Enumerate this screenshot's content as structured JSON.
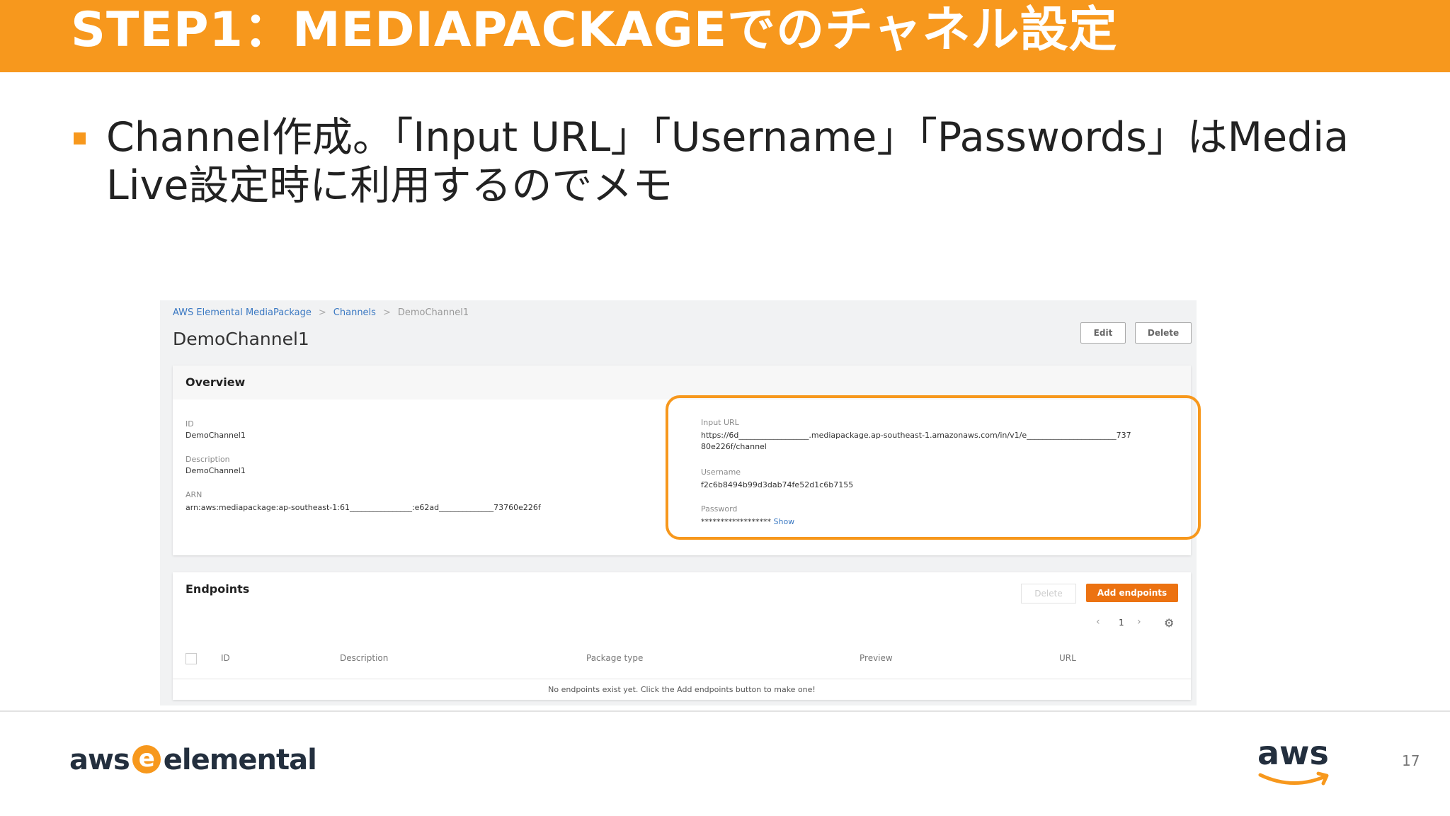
{
  "slide": {
    "title": "STEP1：MEDIAPACKAGEでのチャネル設定",
    "bullet_text": "Channel作成。「Input URL」「Username」「Passwords」はMedia Live設定時に利用するのでメモ",
    "page_number": "17",
    "accent_color": "#f7981d"
  },
  "console": {
    "breadcrumb": [
      "AWS Elemental MediaPackage",
      "Channels",
      "DemoChannel1"
    ],
    "channel_title": "DemoChannel1",
    "edit_button": "Edit",
    "delete_button": "Delete",
    "overview": {
      "title": "Overview",
      "id_label": "ID",
      "id_value": "DemoChannel1",
      "description_label": "Description",
      "description_value": "DemoChannel1",
      "arn_label": "ARN",
      "arn_value": "arn:aws:mediapackage:ap-southeast-1:61________________:e62ad______________73760e226f",
      "input_url_label": "Input URL",
      "input_url_line1": "https://6d__________________.mediapackage.ap-southeast-1.amazonaws.com/in/v1/e_______________________737",
      "input_url_line2": "80e226f/channel",
      "username_label": "Username",
      "username_value": "f2c6b8494b99d3dab74fe52d1c6b7155",
      "password_label": "Password",
      "password_value": "******************",
      "show_link": "Show"
    },
    "endpoints": {
      "title": "Endpoints",
      "delete_button": "Delete",
      "add_button": "Add endpoints",
      "page": "1",
      "columns": [
        "ID",
        "Description",
        "Package type",
        "Preview",
        "URL"
      ],
      "empty_message": "No endpoints exist yet. Click the Add endpoints button to make one!"
    }
  },
  "footer": {
    "left_logo_a": "aws",
    "left_logo_e": "e",
    "left_logo_b": "elemental",
    "right_logo": "aws"
  }
}
